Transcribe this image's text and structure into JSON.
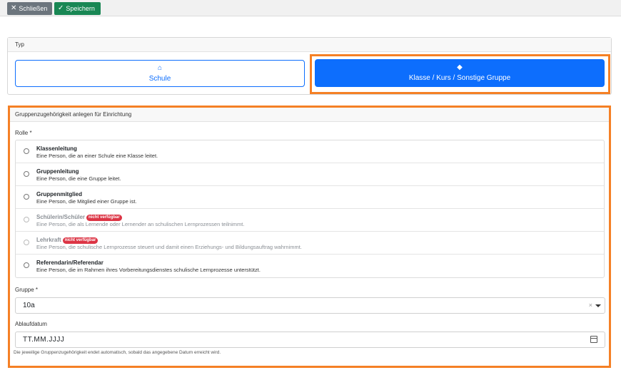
{
  "toolbar": {
    "close_label": "Schließen",
    "save_label": "Speichern",
    "close_icon": "x-icon",
    "save_icon": "check-icon"
  },
  "typ": {
    "header": "Typ",
    "options": [
      {
        "label": "Schule",
        "icon": "house-icon"
      },
      {
        "label": "Klasse / Kurs / Sonstige Gruppe",
        "icon": "graduation-cap-icon",
        "selected": true
      }
    ]
  },
  "gruppe": {
    "header": "Gruppenzugehörigkeit anlegen für Einrichtung",
    "rolle_label": "Rolle *",
    "roles": [
      {
        "title": "Klassenleitung",
        "desc": "Eine Person, die an einer Schule eine Klasse leitet.",
        "disabled": false
      },
      {
        "title": "Gruppenleitung",
        "desc": "Eine Person, die eine Gruppe leitet.",
        "disabled": false
      },
      {
        "title": "Gruppenmitglied",
        "desc": "Eine Person, die Mitglied einer Gruppe ist.",
        "disabled": false
      },
      {
        "title": "Schülerin/Schüler",
        "badge": "nicht verfügbar",
        "desc": "Eine Person, die als Lernende oder Lernender an schulischen Lernprozessen teilnimmt.",
        "disabled": true
      },
      {
        "title": "Lehrkraft",
        "badge": "nicht verfügbar",
        "desc": "Eine Person, die schulische Lernprozesse steuert und damit einen Erziehungs- und Bildungsauftrag wahrnimmt.",
        "disabled": true
      },
      {
        "title": "Referendarin/Referendar",
        "desc": "Eine Person, die im Rahmen ihres Vorbereitungsdienstes schulische Lernprozesse unterstützt.",
        "disabled": false
      }
    ],
    "gruppe_label": "Gruppe *",
    "gruppe_value": "10a",
    "clear_symbol": "×",
    "ablauf_label": "Ablaufdatum",
    "ablauf_placeholder": "TT.MM.JJJJ",
    "hint": "Die jeweilige Gruppenzugehörigkeit endet automatisch, sobald das angegebene Datum erreicht wird."
  },
  "colors": {
    "primary": "#0d6efd",
    "success": "#198754",
    "secondary": "#6c757d",
    "danger": "#dc3545",
    "highlight": "#f58025"
  }
}
